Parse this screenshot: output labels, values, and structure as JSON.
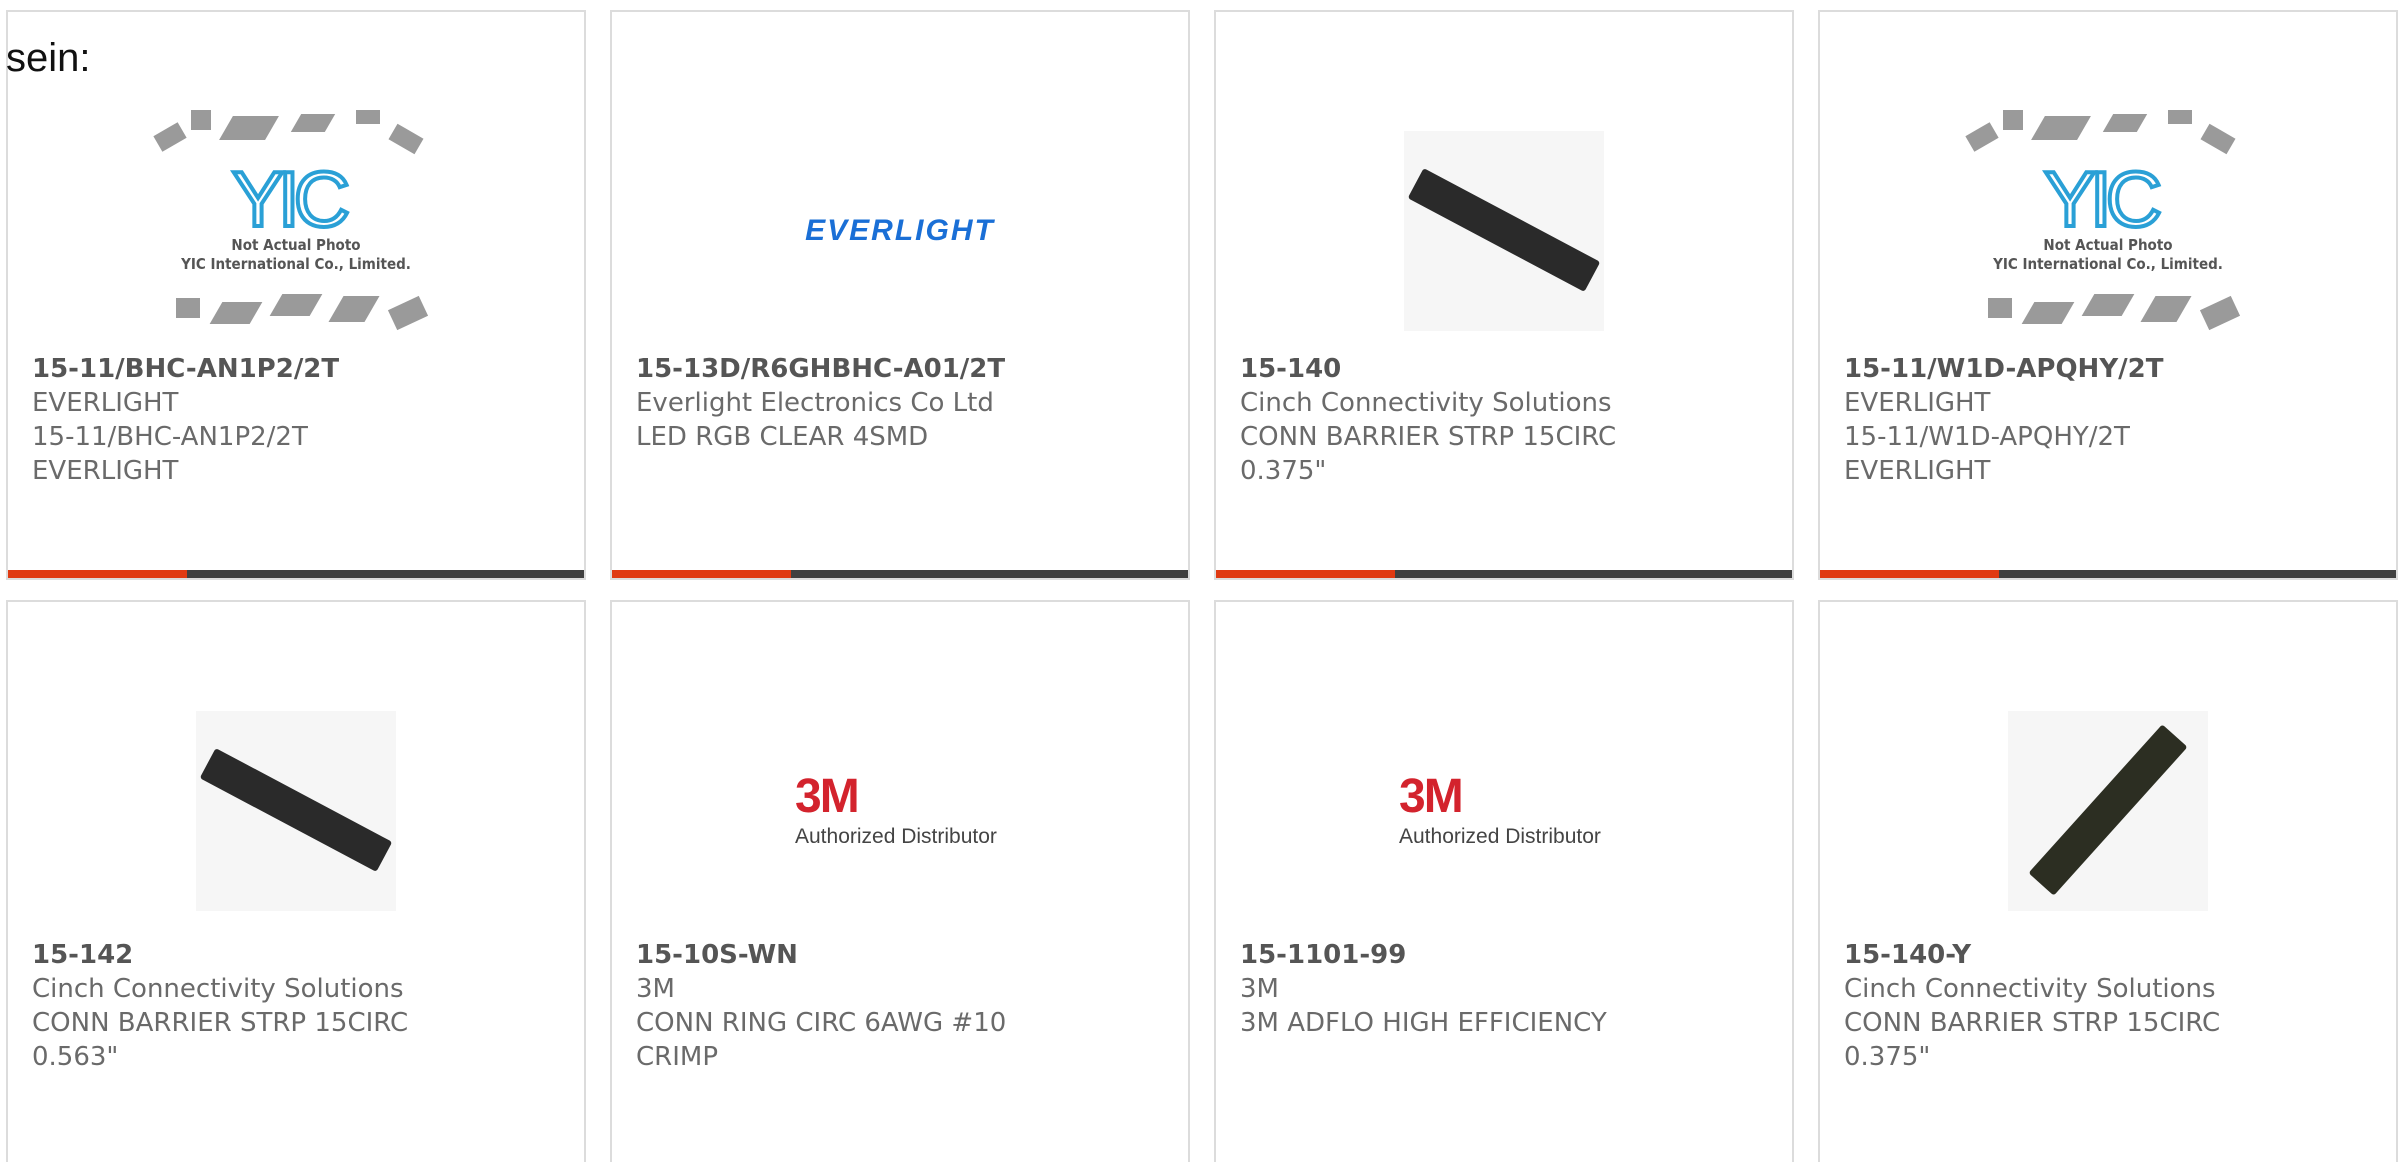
{
  "intro": "sein:",
  "placeholder": {
    "logo": "YIC",
    "line1": "Not Actual Photo",
    "line2": "YIC International Co., Limited."
  },
  "colors": {
    "accent": "#e03a12",
    "bar": "#404040",
    "everlight_blue": "#1a6fd6",
    "red_3m": "#d3232d",
    "yic_blue": "#2aa0d6"
  },
  "progress_fraction": 0.31,
  "cards": [
    {
      "image": "yic-placeholder",
      "part_number": "15-11/BHC-AN1P2/2T",
      "manufacturer": "EVERLIGHT",
      "description_1": "15-11/BHC-AN1P2/2T EVERLIGHT",
      "description_2": ""
    },
    {
      "image": "everlight-logo",
      "logo_text": "EVERLIGHT",
      "part_number": "15-13D/R6GHBHC-A01/2T",
      "manufacturer": "Everlight Electronics Co Ltd",
      "description_1": "LED RGB CLEAR 4SMD",
      "description_2": ""
    },
    {
      "image": "barrier-strip-photo",
      "part_number": "15-140",
      "manufacturer": "Cinch Connectivity Solutions",
      "description_1": "CONN BARRIER STRP 15CIRC",
      "description_2": "0.375\""
    },
    {
      "image": "yic-placeholder",
      "part_number": "15-11/W1D-APQHY/2T",
      "manufacturer": "EVERLIGHT",
      "description_1": "15-11/W1D-APQHY/2T",
      "description_2": "EVERLIGHT"
    },
    {
      "image": "barrier-strip-photo",
      "part_number": "15-142",
      "manufacturer": "Cinch Connectivity Solutions",
      "description_1": "CONN BARRIER STRP 15CIRC",
      "description_2": "0.563\""
    },
    {
      "image": "3m-logo",
      "logo_big": "3M",
      "logo_sub": "Authorized Distributor",
      "part_number": "15-10S-WN",
      "manufacturer": "3M",
      "description_1": "CONN RING CIRC 6AWG #10",
      "description_2": "CRIMP"
    },
    {
      "image": "3m-logo",
      "logo_big": "3M",
      "logo_sub": "Authorized Distributor",
      "part_number": "15-1101-99",
      "manufacturer": "3M",
      "description_1": "3M ADFLO HIGH EFFICIENCY",
      "description_2": ""
    },
    {
      "image": "barrier-strip-photo",
      "part_number": "15-140-Y",
      "manufacturer": "Cinch Connectivity Solutions",
      "description_1": "CONN BARRIER STRP 15CIRC",
      "description_2": "0.375\""
    }
  ]
}
